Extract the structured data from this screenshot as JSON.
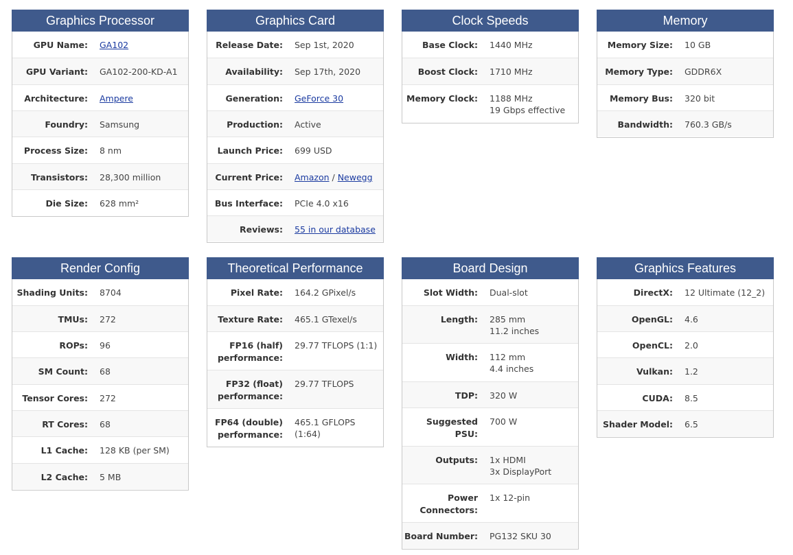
{
  "panels": {
    "graphics_processor": {
      "title": "Graphics Processor",
      "rows": [
        {
          "label": "GPU Name:",
          "value": "GA102"
        },
        {
          "label": "GPU Variant:",
          "value": "GA102-200-KD-A1"
        },
        {
          "label": "Architecture:",
          "value": "Ampere"
        },
        {
          "label": "Foundry:",
          "value": "Samsung"
        },
        {
          "label": "Process Size:",
          "value": "8 nm"
        },
        {
          "label": "Transistors:",
          "value": "28,300 million"
        },
        {
          "label": "Die Size:",
          "value": "628 mm²"
        }
      ]
    },
    "graphics_card": {
      "title": "Graphics Card",
      "rows": [
        {
          "label": "Release Date:",
          "value": "Sep 1st, 2020"
        },
        {
          "label": "Availability:",
          "value": "Sep 17th, 2020"
        },
        {
          "label": "Generation:",
          "value": "GeForce 30"
        },
        {
          "label": "Production:",
          "value": "Active"
        },
        {
          "label": "Launch Price:",
          "value": "699 USD"
        },
        {
          "label": "Current Price:",
          "value_a": "Amazon",
          "separator": " / ",
          "value_b": "Newegg"
        },
        {
          "label": "Bus Interface:",
          "value": "PCIe 4.0 x16"
        },
        {
          "label": "Reviews:",
          "value": "55 in our database"
        }
      ]
    },
    "clock_speeds": {
      "title": "Clock Speeds",
      "rows": [
        {
          "label": "Base Clock:",
          "value": "1440 MHz"
        },
        {
          "label": "Boost Clock:",
          "value": "1710 MHz"
        },
        {
          "label": "Memory Clock:",
          "value": "1188 MHz",
          "value2": "19 Gbps effective"
        }
      ]
    },
    "memory": {
      "title": "Memory",
      "rows": [
        {
          "label": "Memory Size:",
          "value": "10 GB"
        },
        {
          "label": "Memory Type:",
          "value": "GDDR6X"
        },
        {
          "label": "Memory Bus:",
          "value": "320 bit"
        },
        {
          "label": "Bandwidth:",
          "value": "760.3 GB/s"
        }
      ]
    },
    "render_config": {
      "title": "Render Config",
      "rows": [
        {
          "label": "Shading Units:",
          "value": "8704"
        },
        {
          "label": "TMUs:",
          "value": "272"
        },
        {
          "label": "ROPs:",
          "value": "96"
        },
        {
          "label": "SM Count:",
          "value": "68"
        },
        {
          "label": "Tensor Cores:",
          "value": "272"
        },
        {
          "label": "RT Cores:",
          "value": "68"
        },
        {
          "label": "L1 Cache:",
          "value": "128 KB (per SM)"
        },
        {
          "label": "L2 Cache:",
          "value": "5 MB"
        }
      ]
    },
    "theoretical_performance": {
      "title": "Theoretical Performance",
      "rows": [
        {
          "label": "Pixel Rate:",
          "value": "164.2 GPixel/s"
        },
        {
          "label": "Texture Rate:",
          "value": "465.1 GTexel/s"
        },
        {
          "label": "FP16 (half)",
          "label2": "performance:",
          "value": "29.77 TFLOPS (1:1)"
        },
        {
          "label": "FP32 (float)",
          "label2": "performance:",
          "value": "29.77 TFLOPS"
        },
        {
          "label": "FP64 (double)",
          "label2": "performance:",
          "value": "465.1 GFLOPS",
          "value2": "(1:64)"
        }
      ]
    },
    "board_design": {
      "title": "Board Design",
      "rows": [
        {
          "label": "Slot Width:",
          "value": "Dual-slot"
        },
        {
          "label": "Length:",
          "value": "285 mm",
          "value2": "11.2 inches"
        },
        {
          "label": "Width:",
          "value": "112 mm",
          "value2": "4.4 inches"
        },
        {
          "label": "TDP:",
          "value": "320 W"
        },
        {
          "label": "Suggested",
          "label2": "PSU:",
          "value": "700 W"
        },
        {
          "label": "Outputs:",
          "value": "1x HDMI",
          "value2": "3x DisplayPort"
        },
        {
          "label": "Power",
          "label2": "Connectors:",
          "value": "1x 12-pin"
        },
        {
          "label": "Board Number:",
          "value": "PG132 SKU 30"
        }
      ]
    },
    "graphics_features": {
      "title": "Graphics Features",
      "rows": [
        {
          "label": "DirectX:",
          "value": "12 Ultimate (12_2)"
        },
        {
          "label": "OpenGL:",
          "value": "4.6"
        },
        {
          "label": "OpenCL:",
          "value": "2.0"
        },
        {
          "label": "Vulkan:",
          "value": "1.2"
        },
        {
          "label": "CUDA:",
          "value": "8.5"
        },
        {
          "label": "Shader Model:",
          "value": "6.5"
        }
      ]
    }
  },
  "colors": {
    "header_bg": "#3f5a8c",
    "header_text": "#ffffff",
    "link": "#1a3aa0"
  }
}
